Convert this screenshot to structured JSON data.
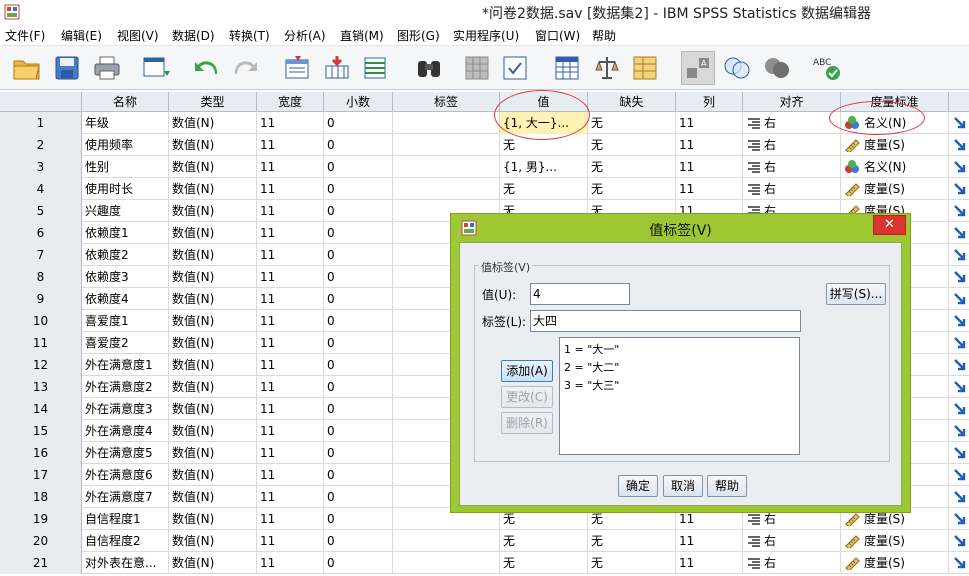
{
  "window": {
    "title": "*问卷2数据.sav [数据集2] - IBM SPSS Statistics 数据编辑器"
  },
  "menu": [
    "文件(F)",
    "编辑(E)",
    "视图(V)",
    "数据(D)",
    "转换(T)",
    "分析(A)",
    "直销(M)",
    "图形(G)",
    "实用程序(U)",
    "窗口(W)",
    "帮助"
  ],
  "toolbar_icons": [
    "open-folder-icon",
    "save-icon",
    "print-icon",
    "dialog-recall-icon",
    "undo-icon",
    "redo-icon",
    "goto-case-icon",
    "goto-variable-icon",
    "variables-icon",
    "find-icon",
    "insert-cases-icon",
    "insert-variable-icon",
    "split-file-icon",
    "weight-cases-icon",
    "select-cases-icon",
    "value-labels-icon",
    "use-sets-icon",
    "show-all-variables-icon",
    "spell-check-icon"
  ],
  "grid": {
    "columns": [
      "",
      "名称",
      "类型",
      "宽度",
      "小数",
      "标签",
      "值",
      "缺失",
      "列",
      "对齐",
      "度量标准"
    ],
    "align_text": "右",
    "rows": [
      {
        "num": "1",
        "name": "年级",
        "type": "数值(N)",
        "width": "11",
        "decimals": "0",
        "label": "",
        "values": "{1, 大一}...",
        "missing": "无",
        "columns": "11",
        "measure": "名义(N)",
        "measure_kind": "nominal"
      },
      {
        "num": "2",
        "name": "使用频率",
        "type": "数值(N)",
        "width": "11",
        "decimals": "0",
        "label": "",
        "values": "无",
        "missing": "无",
        "columns": "11",
        "measure": "度量(S)",
        "measure_kind": "scale"
      },
      {
        "num": "3",
        "name": "性别",
        "type": "数值(N)",
        "width": "11",
        "decimals": "0",
        "label": "",
        "values": "{1, 男}...",
        "missing": "无",
        "columns": "11",
        "measure": "名义(N)",
        "measure_kind": "nominal"
      },
      {
        "num": "4",
        "name": "使用时长",
        "type": "数值(N)",
        "width": "11",
        "decimals": "0",
        "label": "",
        "values": "无",
        "missing": "无",
        "columns": "11",
        "measure": "度量(S)",
        "measure_kind": "scale"
      },
      {
        "num": "5",
        "name": "兴趣度",
        "type": "数值(N)",
        "width": "11",
        "decimals": "0",
        "label": "",
        "values": "无",
        "missing": "无",
        "columns": "11",
        "measure": "度量(S)",
        "measure_kind": "scale"
      },
      {
        "num": "6",
        "name": "依赖度1",
        "type": "数值(N)",
        "width": "11",
        "decimals": "0",
        "label": "",
        "values": "",
        "missing": "",
        "columns": "",
        "measure": "",
        "measure_kind": "scale"
      },
      {
        "num": "7",
        "name": "依赖度2",
        "type": "数值(N)",
        "width": "11",
        "decimals": "0",
        "label": "",
        "values": "",
        "missing": "",
        "columns": "",
        "measure": "",
        "measure_kind": "scale"
      },
      {
        "num": "8",
        "name": "依赖度3",
        "type": "数值(N)",
        "width": "11",
        "decimals": "0",
        "label": "",
        "values": "",
        "missing": "",
        "columns": "",
        "measure": "",
        "measure_kind": "scale"
      },
      {
        "num": "9",
        "name": "依赖度4",
        "type": "数值(N)",
        "width": "11",
        "decimals": "0",
        "label": "",
        "values": "",
        "missing": "",
        "columns": "",
        "measure": "",
        "measure_kind": "scale"
      },
      {
        "num": "10",
        "name": "喜爱度1",
        "type": "数值(N)",
        "width": "11",
        "decimals": "0",
        "label": "",
        "values": "",
        "missing": "",
        "columns": "",
        "measure": "",
        "measure_kind": "scale"
      },
      {
        "num": "11",
        "name": "喜爱度2",
        "type": "数值(N)",
        "width": "11",
        "decimals": "0",
        "label": "",
        "values": "",
        "missing": "",
        "columns": "",
        "measure": "",
        "measure_kind": "scale"
      },
      {
        "num": "12",
        "name": "外在满意度1",
        "type": "数值(N)",
        "width": "11",
        "decimals": "0",
        "label": "",
        "values": "",
        "missing": "",
        "columns": "",
        "measure": "",
        "measure_kind": "scale"
      },
      {
        "num": "13",
        "name": "外在满意度2",
        "type": "数值(N)",
        "width": "11",
        "decimals": "0",
        "label": "",
        "values": "",
        "missing": "",
        "columns": "",
        "measure": "",
        "measure_kind": "scale"
      },
      {
        "num": "14",
        "name": "外在满意度3",
        "type": "数值(N)",
        "width": "11",
        "decimals": "0",
        "label": "",
        "values": "",
        "missing": "",
        "columns": "",
        "measure": "",
        "measure_kind": "scale"
      },
      {
        "num": "15",
        "name": "外在满意度4",
        "type": "数值(N)",
        "width": "11",
        "decimals": "0",
        "label": "",
        "values": "",
        "missing": "",
        "columns": "",
        "measure": "",
        "measure_kind": "scale"
      },
      {
        "num": "16",
        "name": "外在满意度5",
        "type": "数值(N)",
        "width": "11",
        "decimals": "0",
        "label": "",
        "values": "",
        "missing": "",
        "columns": "",
        "measure": "",
        "measure_kind": "scale"
      },
      {
        "num": "17",
        "name": "外在满意度6",
        "type": "数值(N)",
        "width": "11",
        "decimals": "0",
        "label": "",
        "values": "",
        "missing": "",
        "columns": "",
        "measure": "",
        "measure_kind": "scale"
      },
      {
        "num": "18",
        "name": "外在满意度7",
        "type": "数值(N)",
        "width": "11",
        "decimals": "0",
        "label": "",
        "values": "",
        "missing": "",
        "columns": "",
        "measure": "",
        "measure_kind": "scale"
      },
      {
        "num": "19",
        "name": "自信程度1",
        "type": "数值(N)",
        "width": "11",
        "decimals": "0",
        "label": "",
        "values": "无",
        "missing": "无",
        "columns": "11",
        "measure": "度量(S)",
        "measure_kind": "scale"
      },
      {
        "num": "20",
        "name": "自信程度2",
        "type": "数值(N)",
        "width": "11",
        "decimals": "0",
        "label": "",
        "values": "无",
        "missing": "无",
        "columns": "11",
        "measure": "度量(S)",
        "measure_kind": "scale"
      },
      {
        "num": "21",
        "name": "对外表在意...",
        "type": "数值(N)",
        "width": "11",
        "decimals": "0",
        "label": "",
        "values": "无",
        "missing": "无",
        "columns": "11",
        "measure": "度量(S)",
        "measure_kind": "scale"
      }
    ]
  },
  "dialog": {
    "title": "值标签(V)",
    "close": "✕",
    "group_title": "值标签(V)",
    "value_label": "值(U):",
    "value": "4",
    "label_label": "标签(L):",
    "label_value": "大四",
    "spelling": "拼写(S)...",
    "add": "添加(A)",
    "change": "更改(C)",
    "remove": "删除(R)",
    "list": [
      "1 = \"大一\"",
      "2 = \"大二\"",
      "3 = \"大三\""
    ],
    "ok": "确定",
    "cancel": "取消",
    "help": "帮助"
  },
  "colors": {
    "dialog_frame": "#9dc832",
    "close_button": "#d9362f",
    "annotation": "#e0393e",
    "selected_cell": "#fff2b3",
    "header": "#e7ecf3"
  }
}
